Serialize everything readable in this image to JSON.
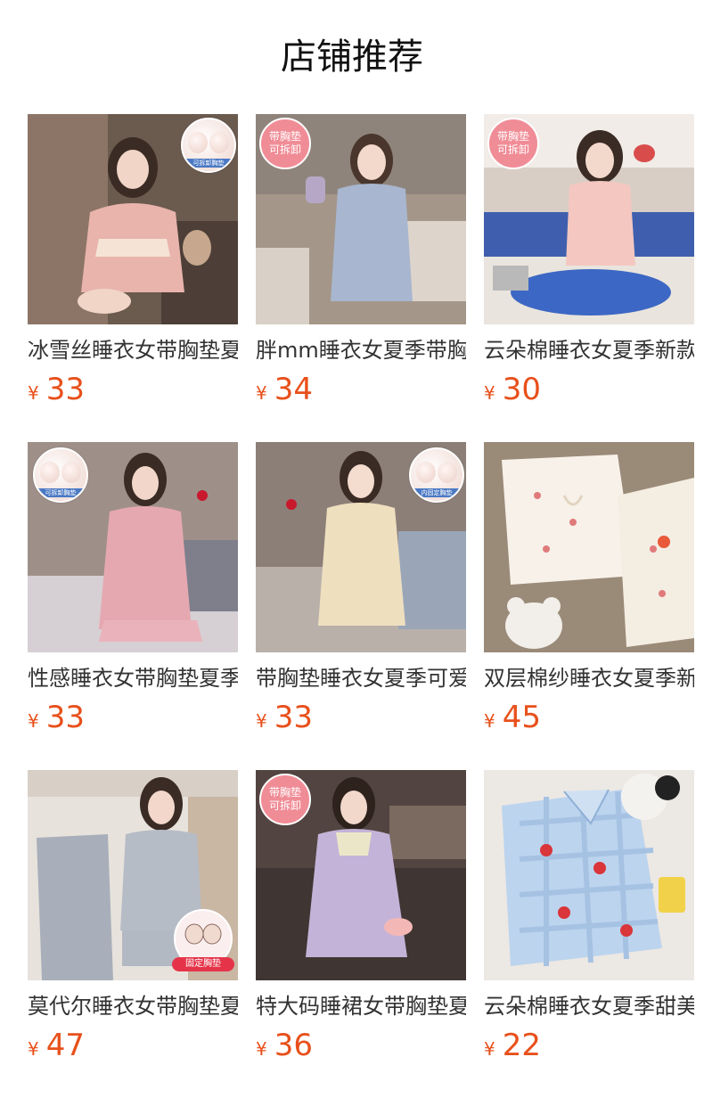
{
  "header": {
    "title": "店铺推荐"
  },
  "products": [
    {
      "name": "冰雪丝睡衣女带胸垫夏季",
      "currency": "¥",
      "price": "33",
      "badge_type": "pad",
      "pad_label": "可拆卸胸垫"
    },
    {
      "name": "胖mm睡衣女夏季带胸垫",
      "currency": "¥",
      "price": "34",
      "badge_type": "pink",
      "badge_line1": "带胸垫",
      "badge_line2": "可拆卸"
    },
    {
      "name": "云朵棉睡衣女夏季新款",
      "currency": "¥",
      "price": "30",
      "badge_type": "pink",
      "badge_line1": "带胸垫",
      "badge_line2": "可拆卸"
    },
    {
      "name": "性感睡衣女带胸垫夏季",
      "currency": "¥",
      "price": "33",
      "badge_type": "pad",
      "pad_label": "可拆卸胸垫"
    },
    {
      "name": "带胸垫睡衣女夏季可爱",
      "currency": "¥",
      "price": "33",
      "badge_type": "pad",
      "pad_label": "内固定胸垫"
    },
    {
      "name": "双层棉纱睡衣女夏季新",
      "currency": "¥",
      "price": "45",
      "badge_type": "none"
    },
    {
      "name": "莫代尔睡衣女带胸垫夏",
      "currency": "¥",
      "price": "47",
      "badge_type": "fixed",
      "fixed_label": "固定胸垫"
    },
    {
      "name": "特大码睡裙女带胸垫夏",
      "currency": "¥",
      "price": "36",
      "badge_type": "pink",
      "badge_line1": "带胸垫",
      "badge_line2": "可拆卸"
    },
    {
      "name": "云朵棉睡衣女夏季甜美",
      "currency": "¥",
      "price": "22",
      "badge_type": "none"
    }
  ],
  "colors": {
    "price": "#e8501b",
    "title": "#111111",
    "name": "#333333",
    "badge_pink": "#f08c96"
  }
}
